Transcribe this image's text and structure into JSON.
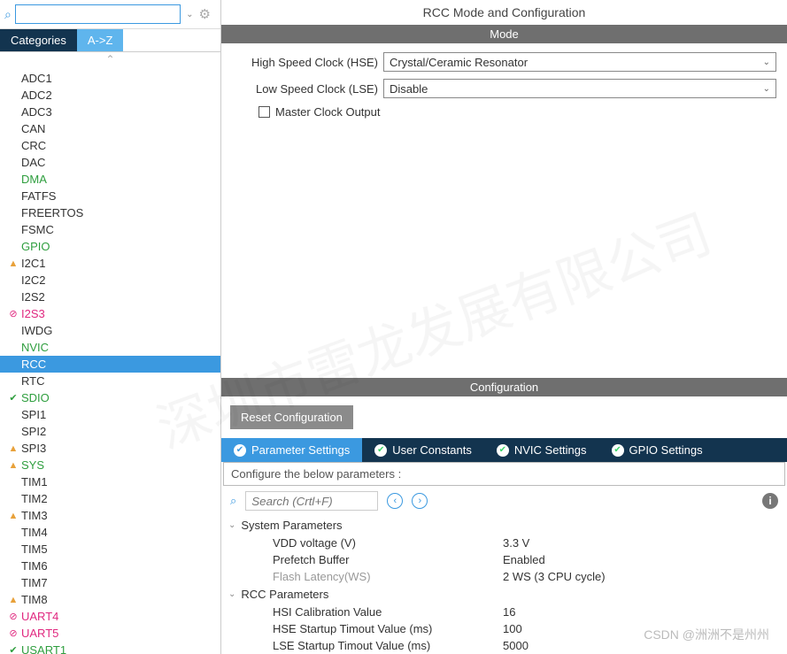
{
  "sidebar": {
    "tabs": {
      "categories": "Categories",
      "az": "A->Z"
    },
    "items": [
      {
        "label": "ADC1",
        "color": "c-default",
        "icon": ""
      },
      {
        "label": "ADC2",
        "color": "c-default",
        "icon": ""
      },
      {
        "label": "ADC3",
        "color": "c-default",
        "icon": ""
      },
      {
        "label": "CAN",
        "color": "c-default",
        "icon": ""
      },
      {
        "label": "CRC",
        "color": "c-default",
        "icon": ""
      },
      {
        "label": "DAC",
        "color": "c-default",
        "icon": ""
      },
      {
        "label": "DMA",
        "color": "c-green",
        "icon": ""
      },
      {
        "label": "FATFS",
        "color": "c-default",
        "icon": ""
      },
      {
        "label": "FREERTOS",
        "color": "c-default",
        "icon": ""
      },
      {
        "label": "FSMC",
        "color": "c-default",
        "icon": ""
      },
      {
        "label": "GPIO",
        "color": "c-green",
        "icon": ""
      },
      {
        "label": "I2C1",
        "color": "c-default",
        "icon": "warn"
      },
      {
        "label": "I2C2",
        "color": "c-default",
        "icon": ""
      },
      {
        "label": "I2S2",
        "color": "c-default",
        "icon": ""
      },
      {
        "label": "I2S3",
        "color": "c-err",
        "icon": "err"
      },
      {
        "label": "IWDG",
        "color": "c-default",
        "icon": ""
      },
      {
        "label": "NVIC",
        "color": "c-green",
        "icon": ""
      },
      {
        "label": "RCC",
        "color": "c-green",
        "icon": "",
        "selected": true
      },
      {
        "label": "RTC",
        "color": "c-default",
        "icon": ""
      },
      {
        "label": "SDIO",
        "color": "c-green",
        "icon": "ok"
      },
      {
        "label": "SPI1",
        "color": "c-default",
        "icon": ""
      },
      {
        "label": "SPI2",
        "color": "c-default",
        "icon": ""
      },
      {
        "label": "SPI3",
        "color": "c-default",
        "icon": "warn"
      },
      {
        "label": "SYS",
        "color": "c-green",
        "icon": "warn"
      },
      {
        "label": "TIM1",
        "color": "c-default",
        "icon": ""
      },
      {
        "label": "TIM2",
        "color": "c-default",
        "icon": ""
      },
      {
        "label": "TIM3",
        "color": "c-default",
        "icon": "warn"
      },
      {
        "label": "TIM4",
        "color": "c-default",
        "icon": ""
      },
      {
        "label": "TIM5",
        "color": "c-default",
        "icon": ""
      },
      {
        "label": "TIM6",
        "color": "c-default",
        "icon": ""
      },
      {
        "label": "TIM7",
        "color": "c-default",
        "icon": ""
      },
      {
        "label": "TIM8",
        "color": "c-default",
        "icon": "warn"
      },
      {
        "label": "UART4",
        "color": "c-err",
        "icon": "err"
      },
      {
        "label": "UART5",
        "color": "c-err",
        "icon": "err"
      },
      {
        "label": "USART1",
        "color": "c-green",
        "icon": "ok"
      }
    ]
  },
  "main": {
    "title": "RCC Mode and Configuration",
    "mode_bar": "Mode",
    "hse_label": "High Speed Clock (HSE)",
    "hse_value": "Crystal/Ceramic Resonator",
    "lse_label": "Low Speed Clock (LSE)",
    "lse_value": "Disable",
    "master_clock": "Master Clock Output",
    "config_bar": "Configuration",
    "reset_btn": "Reset Configuration",
    "cfg_tabs": {
      "param": "Parameter Settings",
      "user": "User Constants",
      "nvic": "NVIC Settings",
      "gpio": "GPIO Settings"
    },
    "hint": "Configure the below parameters :",
    "search_ph": "Search (Crtl+F)",
    "groups": [
      {
        "name": "System Parameters",
        "rows": [
          {
            "n": "VDD voltage (V)",
            "v": "3.3 V",
            "gray": false
          },
          {
            "n": "Prefetch Buffer",
            "v": "Enabled",
            "gray": false
          },
          {
            "n": "Flash Latency(WS)",
            "v": "2 WS (3 CPU cycle)",
            "gray": true
          }
        ]
      },
      {
        "name": "RCC Parameters",
        "rows": [
          {
            "n": "HSI Calibration Value",
            "v": "16",
            "gray": false
          },
          {
            "n": "HSE Startup Timout Value (ms)",
            "v": "100",
            "gray": false
          },
          {
            "n": "LSE Startup Timout Value (ms)",
            "v": "5000",
            "gray": false
          }
        ]
      }
    ]
  },
  "watermark": "CSDN @洲洲不是州州",
  "watermark_big": "深圳市雷龙发展有限公司"
}
